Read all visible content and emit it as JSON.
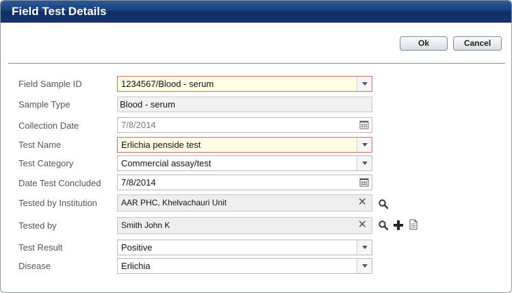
{
  "dialog": {
    "title": "Field Test Details",
    "ok_label": "Ok",
    "cancel_label": "Cancel"
  },
  "form": {
    "field_sample_id": {
      "label": "Field Sample ID",
      "value": "1234567/Blood - serum"
    },
    "sample_type": {
      "label": "Sample Type",
      "value": "Blood - serum"
    },
    "collection_date": {
      "label": "Collection Date",
      "value": "7/8/2014"
    },
    "test_name": {
      "label": "Test Name",
      "value": "Erlichia penside test"
    },
    "test_category": {
      "label": "Test Category",
      "value": "Commercial assay/test"
    },
    "date_test_concluded": {
      "label": "Date Test Concluded",
      "value": "7/8/2014"
    },
    "tested_by_institution": {
      "label": "Tested by Institution",
      "value": "AAR PHC, Khelvachauri Unit"
    },
    "tested_by": {
      "label": "Tested by",
      "value": "Smith John K"
    },
    "test_result": {
      "label": "Test Result",
      "value": "Positive"
    },
    "disease": {
      "label": "Disease",
      "value": "Erlichia"
    }
  },
  "colors": {
    "titlebar": "#1a3f7d",
    "required_field_bg": "#fffde4",
    "required_field_border": "#d0646a",
    "divider": "#6f9e93"
  },
  "icons": {
    "dropdown": "chevron-down-icon",
    "calendar": "calendar-icon",
    "clear": "clear-icon",
    "search": "search-icon",
    "add": "add-icon",
    "details": "document-icon"
  }
}
